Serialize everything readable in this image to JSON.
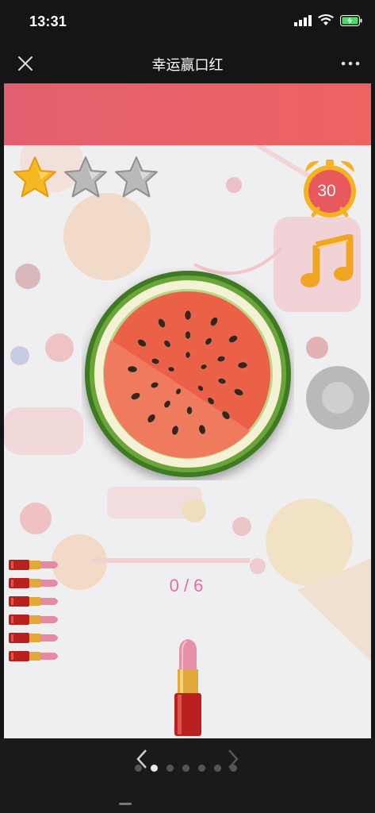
{
  "status": {
    "time": "13:31"
  },
  "nav": {
    "title": "幸运赢口红"
  },
  "game": {
    "stars": [
      {
        "state": "filled",
        "color": "#f5b820"
      },
      {
        "state": "empty",
        "color": "#b9b9b9"
      },
      {
        "state": "empty",
        "color": "#b9b9b9"
      }
    ],
    "timer": "30",
    "counter": "0 / 6",
    "lipsticks_remaining": 6,
    "accent_color": "#e86aa4",
    "header_color": "#e8626b"
  },
  "pager": {
    "active_index": 1,
    "total": 7
  }
}
